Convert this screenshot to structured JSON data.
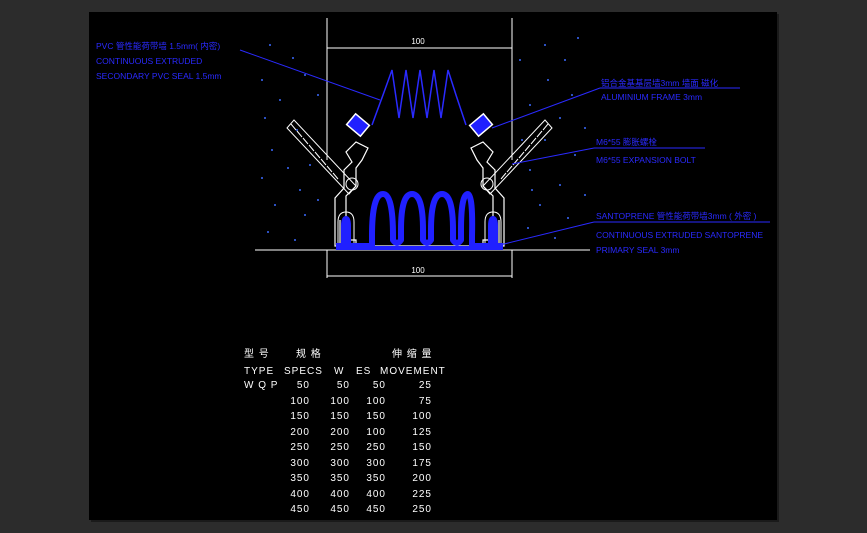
{
  "drawing": {
    "dim_top": "100",
    "dim_bottom": "100",
    "annotations": {
      "pvc_seal": {
        "line1": "PVC 管性能荷带墙 1.5mm( 内密)",
        "line2": "CONTINUOUS EXTRUDED",
        "line3": "SECONDARY PVC SEAL 1.5mm"
      },
      "aluminium_frame": {
        "line1": "铝合金基基层墙3mm 墙面 磁化",
        "line2": "ALUMINIUM FRAME 3mm"
      },
      "expansion_bolt": {
        "line1": "M6*55 膨胀螺栓",
        "line2": "M6*55 EXPANSION BOLT"
      },
      "santoprene_seal": {
        "line1": "SANTOPRENE 管性能荷带墙3mm ( 外密 )",
        "line2": "CONTINUOUS EXTRUDED SANTOPRENE",
        "line3": "PRIMARY SEAL 3mm"
      }
    },
    "colors": {
      "background": "#000000",
      "frame_line": "#ffffff",
      "annotation": "#1a1aff",
      "seal_fill": "#2020ff"
    }
  },
  "table": {
    "header_cn": [
      "型 号",
      "规 格",
      "伸 缩 量"
    ],
    "header_en": [
      "TYPE",
      "SPECS",
      "W",
      "ES",
      "MOVEMENT"
    ],
    "rows": [
      [
        "W Q P",
        "50",
        "50",
        "50",
        "25"
      ],
      [
        "",
        "100",
        "100",
        "100",
        "75"
      ],
      [
        "",
        "150",
        "150",
        "150",
        "100"
      ],
      [
        "",
        "200",
        "200",
        "100",
        "125"
      ],
      [
        "",
        "250",
        "250",
        "250",
        "150"
      ],
      [
        "",
        "300",
        "300",
        "300",
        "175"
      ],
      [
        "",
        "350",
        "350",
        "350",
        "200"
      ],
      [
        "",
        "400",
        "400",
        "400",
        "225"
      ],
      [
        "",
        "450",
        "450",
        "450",
        "250"
      ]
    ]
  }
}
